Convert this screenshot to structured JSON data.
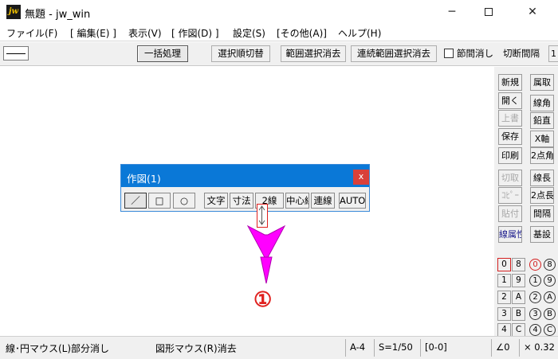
{
  "window": {
    "icon_text": "jw",
    "title": "無題 - jw_win",
    "minimize_glyph": "─",
    "close_glyph": "✕"
  },
  "menu": [
    "ファイル(F)",
    "[ 編集(E) ]",
    "表示(V)",
    "[ 作図(D) ]",
    "設定(S)",
    "[その他(A)]",
    "ヘルプ(H)"
  ],
  "toolbar": {
    "batch_process": "一括処理",
    "select_order_switch": "選択順切替",
    "range_select_clear": "範囲選択消去",
    "continuous_range_clear": "連続範囲選択消去",
    "node_clear_label": "節間消し",
    "cut_interval": "切断間隔",
    "edge_text": "1"
  },
  "right_panel": {
    "col1": [
      "新規",
      "開く",
      "上書",
      "保存",
      "印刷",
      "切取",
      "ｺﾋﾟｰ",
      "貼付",
      "線属性"
    ],
    "col2": [
      "属取",
      "線角",
      "鉛直",
      "X軸",
      "2点角",
      "線長",
      "2点長",
      "間隔",
      "基設"
    ],
    "layer_left": [
      [
        "0",
        "8"
      ],
      [
        "1",
        "9"
      ],
      [
        "2",
        "A"
      ],
      [
        "3",
        "B"
      ],
      [
        "4",
        "C"
      ]
    ],
    "layer_right": [
      "0",
      "8",
      "1",
      "9",
      "2",
      "A",
      "3",
      "B",
      "4",
      "C"
    ]
  },
  "float_window": {
    "title": "作図(1)",
    "close": "x",
    "buttons": {
      "line": "／",
      "rect": "□",
      "circle": "○",
      "text": "文字",
      "dimension": "寸法",
      "double_line": "2線",
      "center_line": "中心線",
      "continuous_line": "連線",
      "auto": "AUTO"
    }
  },
  "annotation": {
    "number": "①",
    "arrow_color": "#ff00ff",
    "marker_color": "#e0201e"
  },
  "status": {
    "left_hint": "線･円マウス(L)部分消し",
    "right_hint": "図形マウス(R)消去",
    "paper": "A-4",
    "scale": "S=1/50",
    "layer": "[0-0]",
    "angle": "∠0",
    "factor": "× 0.32"
  },
  "colors": {
    "titlebar_accent": "#0a78d7",
    "close_button": "#d9403a"
  }
}
